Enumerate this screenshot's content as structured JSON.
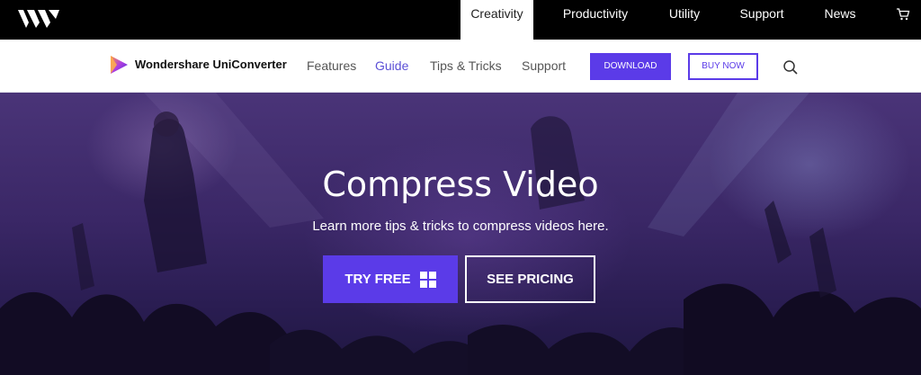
{
  "topbar": {
    "logo": "wondershare-logo",
    "items": [
      {
        "label": "Creativity",
        "active": true
      },
      {
        "label": "Productivity",
        "active": false
      },
      {
        "label": "Utility",
        "active": false
      },
      {
        "label": "Support",
        "active": false
      },
      {
        "label": "News",
        "active": false
      }
    ],
    "cart_icon": "shopping-cart-icon"
  },
  "product_nav": {
    "brand_icon": "uniconverter-logo-icon",
    "brand": "Wondershare UniConverter",
    "links": [
      {
        "label": "Features",
        "current": false
      },
      {
        "label": "Guide",
        "current": true
      },
      {
        "label": "Tips & Tricks",
        "current": false
      },
      {
        "label": "Support",
        "current": false
      }
    ],
    "download_label": "DOWNLOAD",
    "buy_label": "BUY NOW",
    "search_icon": "search-icon"
  },
  "hero": {
    "title": "Compress Video",
    "subtitle": "Learn more tips & tricks to compress videos here.",
    "try_label": "TRY FREE",
    "try_icon": "windows-icon",
    "pricing_label": "SEE PRICING"
  },
  "colors": {
    "accent": "#5b3be8",
    "nav_current": "#5b4fd6",
    "topbar_bg": "#000000"
  }
}
